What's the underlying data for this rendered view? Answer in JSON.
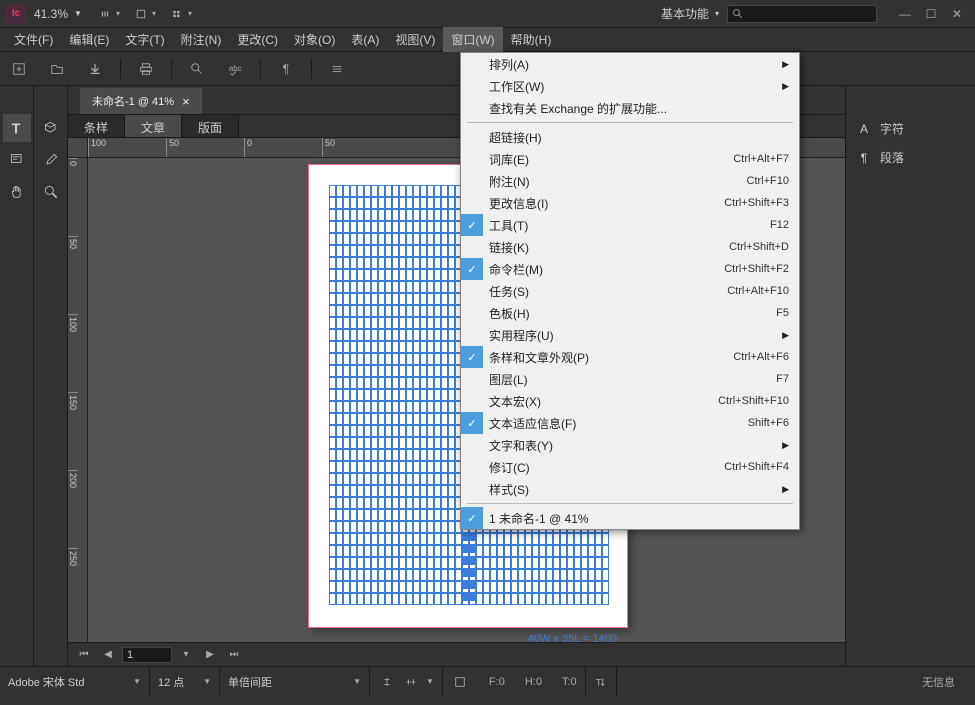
{
  "app": {
    "icon_text": "Ic"
  },
  "titlebar": {
    "zoom": "41.3%",
    "workspace": "基本功能"
  },
  "menubar": {
    "items": [
      "文件(F)",
      "编辑(E)",
      "文字(T)",
      "附注(N)",
      "更改(C)",
      "对象(O)",
      "表(A)",
      "视图(V)",
      "窗口(W)",
      "帮助(H)"
    ],
    "active_index": 8
  },
  "doc_tab": {
    "label": "未命名-1 @ 41%"
  },
  "panel_tabs": {
    "items": [
      "条样",
      "文章",
      "版面"
    ],
    "active_index": 1
  },
  "ruler_h": [
    "100",
    "50",
    "0",
    "50"
  ],
  "ruler_v": [
    "0",
    "50",
    "100",
    "150",
    "200",
    "250"
  ],
  "page": {
    "caption": "40W x 35L = 1400"
  },
  "right_panels": {
    "items": [
      {
        "icon": "A",
        "label": "字符"
      },
      {
        "icon": "¶",
        "label": "段落"
      }
    ]
  },
  "dropdown": {
    "items": [
      {
        "label": "排列(A)",
        "submenu": true
      },
      {
        "label": "工作区(W)",
        "submenu": true
      },
      {
        "label": "查找有关 Exchange 的扩展功能..."
      },
      {
        "sep": true
      },
      {
        "label": "超链接(H)"
      },
      {
        "label": "词库(E)",
        "shortcut": "Ctrl+Alt+F7"
      },
      {
        "label": "附注(N)",
        "shortcut": "Ctrl+F10"
      },
      {
        "label": "更改信息(I)",
        "shortcut": "Ctrl+Shift+F3"
      },
      {
        "label": "工具(T)",
        "shortcut": "F12",
        "checked": true
      },
      {
        "label": "链接(K)",
        "shortcut": "Ctrl+Shift+D"
      },
      {
        "label": "命令栏(M)",
        "shortcut": "Ctrl+Shift+F2",
        "checked": true
      },
      {
        "label": "任务(S)",
        "shortcut": "Ctrl+Alt+F10"
      },
      {
        "label": "色板(H)",
        "shortcut": "F5"
      },
      {
        "label": "实用程序(U)",
        "submenu": true
      },
      {
        "label": "条样和文章外观(P)",
        "shortcut": "Ctrl+Alt+F6",
        "checked": true
      },
      {
        "label": "图层(L)",
        "shortcut": "F7"
      },
      {
        "label": "文本宏(X)",
        "shortcut": "Ctrl+Shift+F10"
      },
      {
        "label": "文本适应信息(F)",
        "shortcut": "Shift+F6",
        "checked": true
      },
      {
        "label": "文字和表(Y)",
        "submenu": true
      },
      {
        "label": "修订(C)",
        "shortcut": "Ctrl+Shift+F4"
      },
      {
        "label": "样式(S)",
        "submenu": true
      },
      {
        "sep": true
      },
      {
        "label": "1 未命名-1 @ 41%",
        "checked": true
      }
    ]
  },
  "bottom_nav": {
    "page": "1"
  },
  "statusbar": {
    "font": "Adobe 宋体 Std",
    "size": "12 点",
    "leading": "单倍间距",
    "f": "F:0",
    "h": "H:0",
    "t": "T:0",
    "info": "无信息"
  }
}
